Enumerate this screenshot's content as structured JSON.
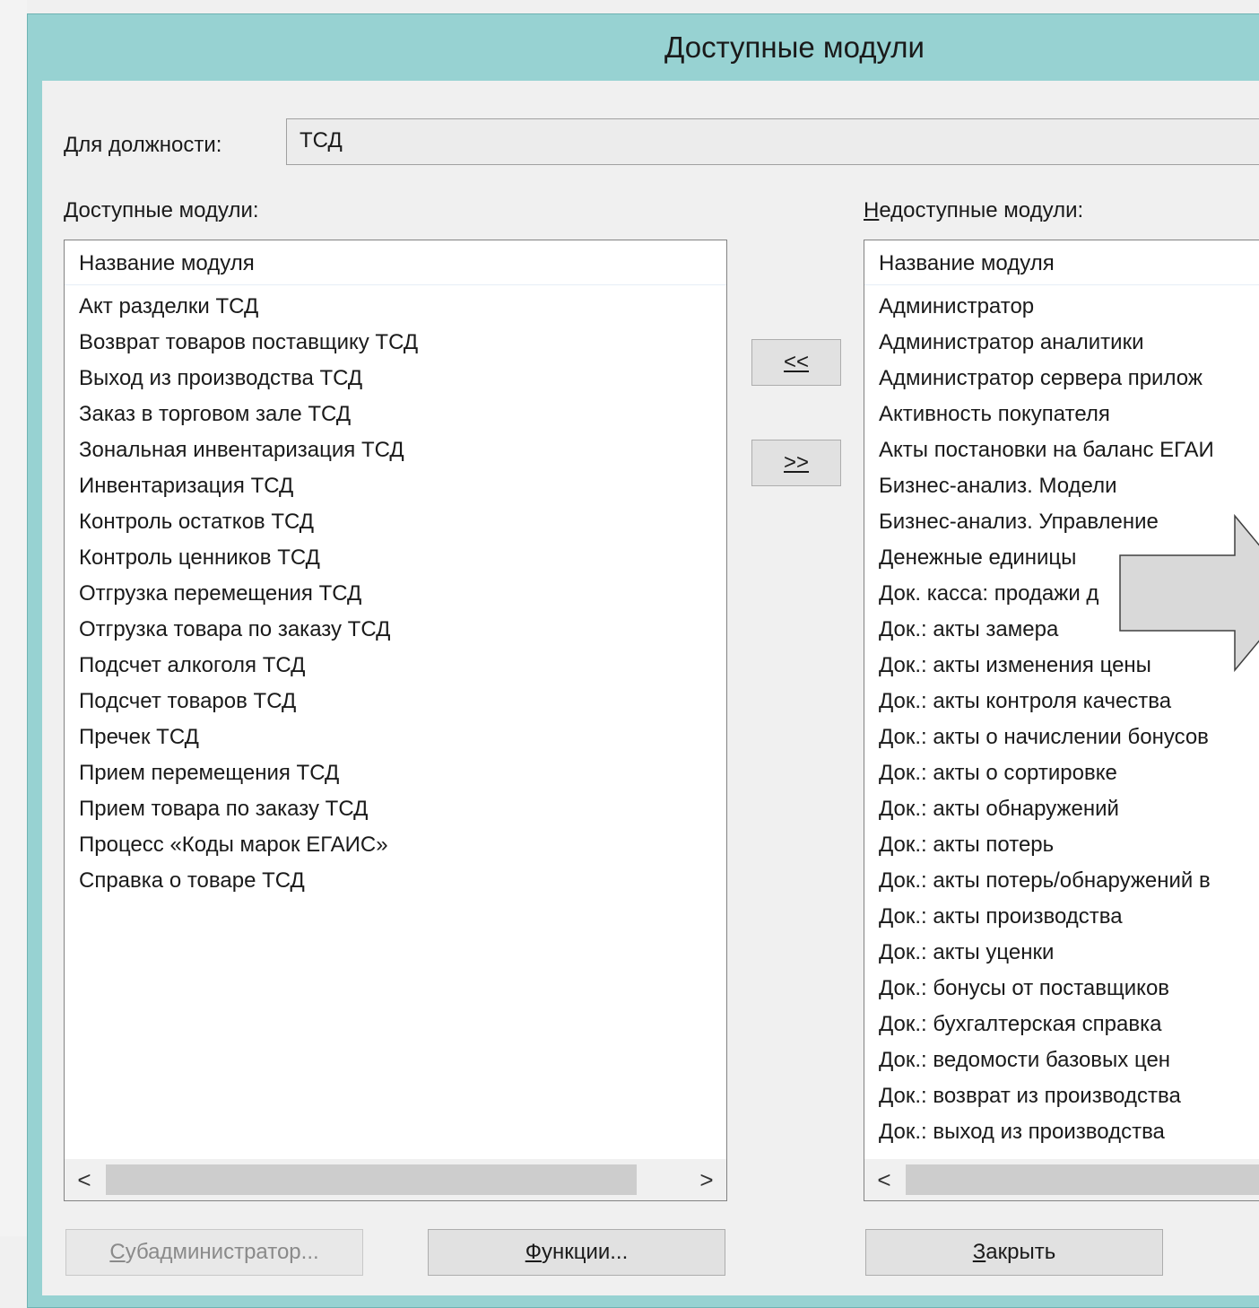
{
  "window": {
    "title": "Доступные модули"
  },
  "position": {
    "label": "Для должности:",
    "value": "ТСД"
  },
  "available": {
    "label_first": "Д",
    "label_rest": "оступные модули:",
    "column_header": "Название модуля",
    "items": [
      "Акт разделки ТСД",
      "Возврат товаров поставщику ТСД",
      "Выход из производства ТСД",
      "Заказ в торговом зале ТСД",
      "Зональная инвентаризация ТСД",
      "Инвентаризация ТСД",
      "Контроль остатков ТСД",
      "Контроль ценников ТСД",
      "Отгрузка перемещения ТСД",
      "Отгрузка товара по заказу ТСД",
      "Подсчет алкоголя ТСД",
      "Подсчет товаров ТСД",
      "Пречек ТСД",
      "Прием перемещения ТСД",
      "Прием товара по заказу ТСД",
      "Процесс «Коды марок ЕГАИС»",
      "Справка о товаре ТСД"
    ]
  },
  "unavailable": {
    "label_first": "Н",
    "label_rest": "едоступные модули:",
    "column_header": "Название модуля",
    "items": [
      "Администратор",
      "Администратор аналитики",
      "Администратор сервера прилож",
      "Активность покупателя",
      "Акты постановки на баланс ЕГАИ",
      "Бизнес-анализ. Модели",
      "Бизнес-анализ. Управление",
      "Денежные единицы",
      "Док. касса: продажи д",
      "Док.: акты замера",
      "Док.: акты изменения цены",
      "Док.: акты контроля качества",
      "Док.: акты о начислении бонусов",
      "Док.: акты о сортировке",
      "Док.: акты обнаружений",
      "Док.: акты потерь",
      "Док.: акты потерь/обнаружений в",
      "Док.: акты производства",
      "Док.: акты уценки",
      "Док.: бонусы от поставщиков",
      "Док.: бухгалтерская справка",
      "Док.: ведомости базовых цен",
      "Док.: возврат из производства",
      "Док.: выход из производства"
    ]
  },
  "transfer": {
    "to_available": "<<",
    "to_unavailable": ">>"
  },
  "buttons": {
    "subadmin_first": "С",
    "subadmin_rest": "убадминистратор...",
    "functions_first": "Ф",
    "functions_rest": "ункции...",
    "close_first": "З",
    "close_rest": "акрыть"
  },
  "scroll": {
    "left_arrow": "<",
    "right_arrow": ">"
  },
  "icons": {
    "callout": "right-arrow-callout-icon"
  },
  "colors": {
    "titlebar": "#97d2d2",
    "client": "#f0f0f0",
    "list_background": "#ffffff",
    "callout_fill": "#d9d9d9"
  }
}
